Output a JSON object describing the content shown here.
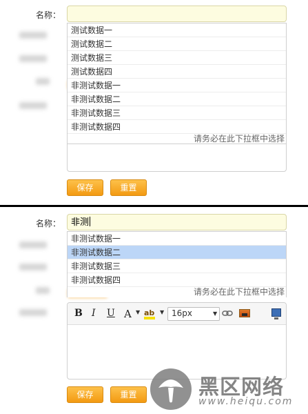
{
  "form": {
    "name_label": "名称：",
    "save_label": "保存",
    "reset_label": "重置",
    "dropdown_hint": "请务必在此下拉框中选择",
    "font_size": "16px"
  },
  "state_a": {
    "input_value": "",
    "suggestions": [
      "测试数据一",
      "测试数据二",
      "测试数据三",
      "测试数据四",
      "非测试数据一",
      "非测试数据二",
      "非测试数据三",
      "非测试数据四"
    ]
  },
  "state_b": {
    "input_value": "非测",
    "selected_index": 1,
    "suggestions": [
      "非测试数据一",
      "非测试数据二",
      "非测试数据三",
      "非测试数据四"
    ]
  },
  "toolbar": {
    "bold": "B",
    "italic": "I",
    "underline": "U",
    "font_color": "A",
    "highlight": "ab"
  },
  "watermark": {
    "text": "黑区网络",
    "url": "www.heiqu.com"
  },
  "colors": {
    "accent_orange": "#f39a12",
    "input_bg": "#fdfce0",
    "selection_blue": "#bcd6f7"
  },
  "icons": [
    "dropdown-arrow-icon",
    "link-icon",
    "image-icon",
    "monitor-icon",
    "mushroom-logo-icon"
  ]
}
